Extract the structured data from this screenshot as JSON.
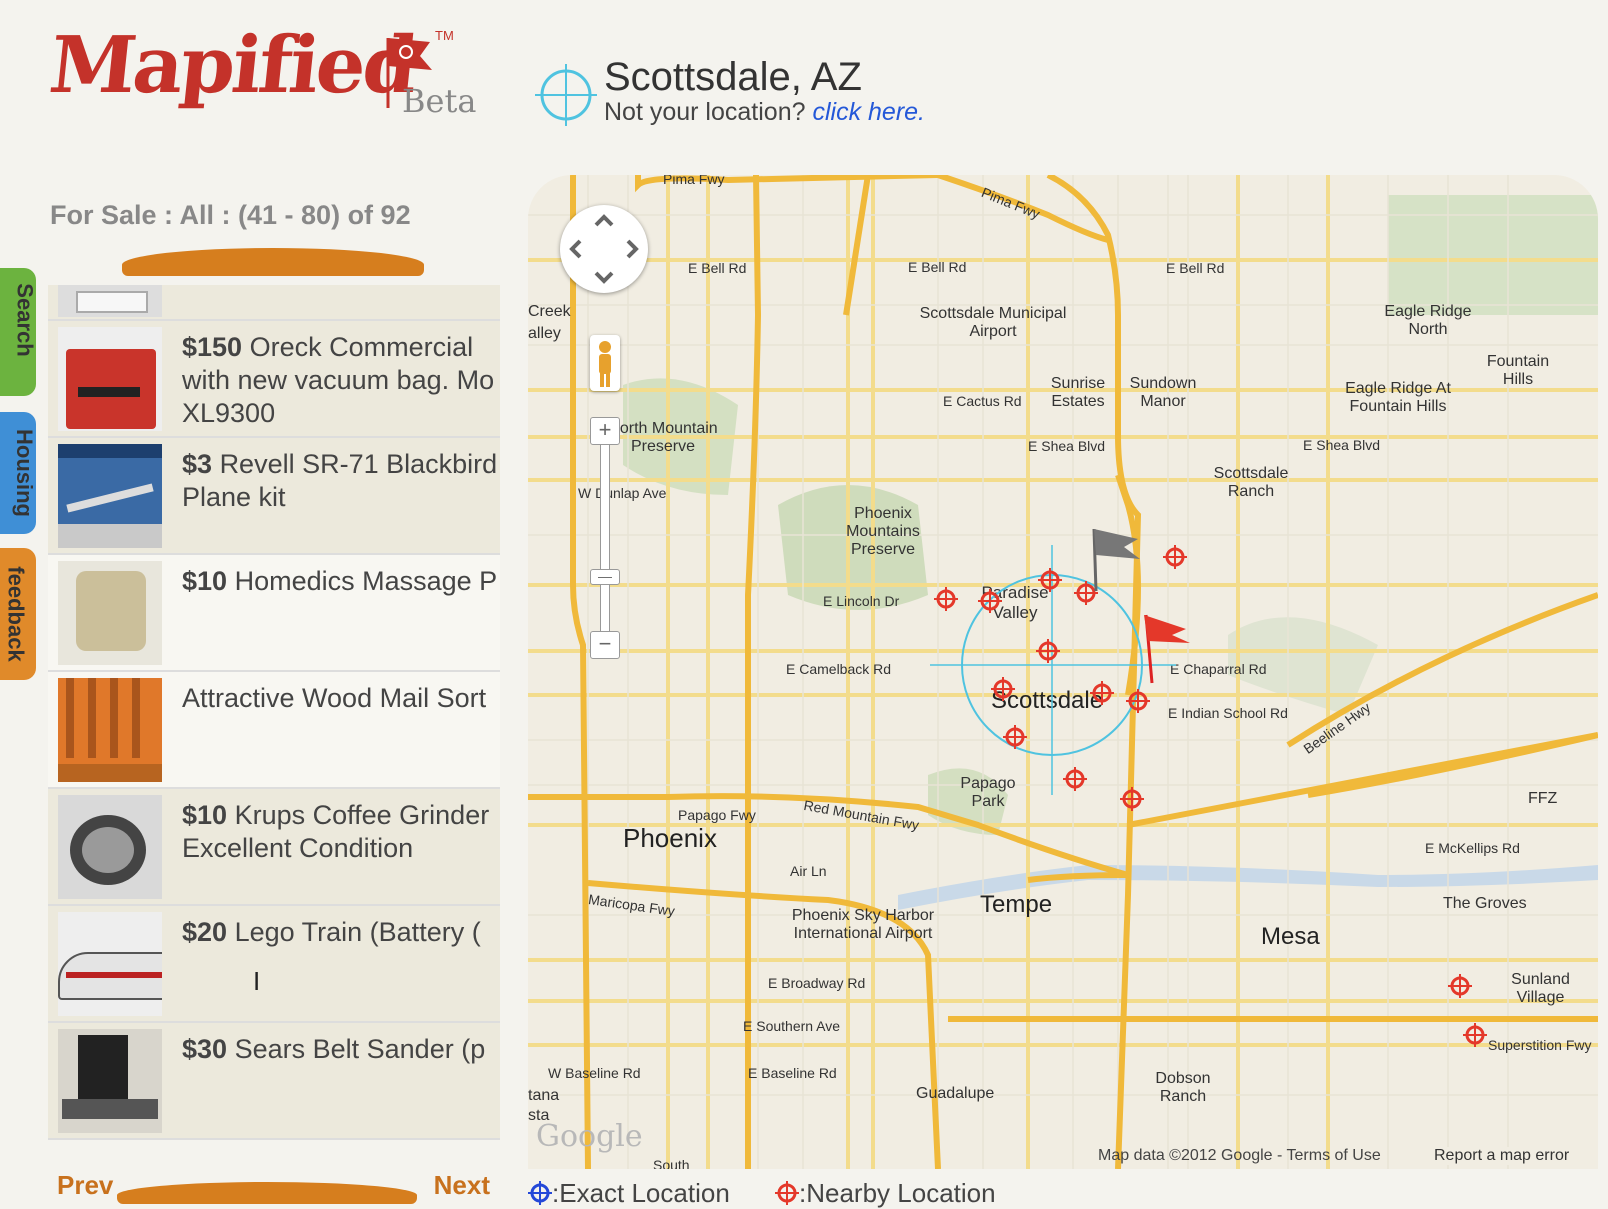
{
  "logo": {
    "name": "Mapified",
    "tm": "TM",
    "beta": "Beta"
  },
  "location": {
    "city": "Scottsdale, AZ",
    "prompt": "Not your location?",
    "link": "click here."
  },
  "side_tabs": [
    {
      "label": "Search",
      "color": "#6cb33f"
    },
    {
      "label": "Housing",
      "color": "#3f8fd6"
    },
    {
      "label": "feedback",
      "color": "#e08a2a"
    }
  ],
  "listing": {
    "header": "For Sale :  All :  (41 - 80) of 92",
    "items": [
      {
        "price": "$150",
        "title": "Oreck Commercial",
        "line2": "with new vacuum bag. Mo",
        "line3": "XL9300"
      },
      {
        "price": "$3",
        "title": "Revell SR-71 Blackbird",
        "line2": "Plane kit",
        "line3": ""
      },
      {
        "price": "$10",
        "title": "Homedics Massage P",
        "line2": "",
        "line3": ""
      },
      {
        "price": "",
        "title": "Attractive Wood Mail Sort",
        "line2": "",
        "line3": ""
      },
      {
        "price": "$10",
        "title": "Krups Coffee Grinder",
        "line2": "Excellent Condition",
        "line3": ""
      },
      {
        "price": "$20",
        "title": "Lego Train (Battery (",
        "line2": "",
        "line3": ""
      },
      {
        "price": "$30",
        "title": "Sears Belt Sander (p",
        "line2": "",
        "line3": ""
      }
    ],
    "prev": "Prev",
    "next": "Next"
  },
  "map": {
    "labels": {
      "phoenix": "Phoenix",
      "scottsdale": "Scottsdale",
      "tempe": "Tempe",
      "mesa": "Mesa",
      "paradise_valley": "Paradise Valley",
      "scottsdale_airport": "Scottsdale Municipal Airport",
      "sunrise": "Sunrise Estates",
      "sundown": "Sundown Manor",
      "eagle_ridge": "Eagle Ridge North",
      "fountain_hills": "Fountain Hills",
      "eagle_ridge_fh": "Eagle Ridge At Fountain Hills",
      "scottsdale_ranch": "Scottsdale Ranch",
      "phoenix_mountains": "Phoenix Mountains Preserve",
      "north_mountain": "North Mountain Preserve",
      "papago_park": "Papago Park",
      "sky_harbor": "Phoenix Sky Harbor International Airport",
      "the_groves": "The Groves",
      "sunland": "Sunland Village",
      "dobson": "Dobson Ranch",
      "guadalupe": "Guadalupe",
      "e_bell_rd": "E Bell Rd",
      "e_cactus_rd": "E Cactus Rd",
      "e_shea_blvd": "E Shea Blvd",
      "w_dunlap": "W Dunlap Ave",
      "e_lincoln": "E Lincoln Dr",
      "e_camelback": "E Camelback Rd",
      "e_chaparral": "E Chaparral Rd",
      "e_indian_school": "E Indian School Rd",
      "papago_fwy": "Papago Fwy",
      "red_mountain": "Red Mountain Fwy",
      "maricopa_fwy": "Maricopa Fwy",
      "air_ln": "Air Ln",
      "e_broadway": "E Broadway Rd",
      "e_southern": "E Southern Ave",
      "w_baseline": "W Baseline Rd",
      "e_baseline": "E Baseline Rd",
      "e_mckellips": "E McKellips Rd",
      "pima_fwy": "Pima Fwy",
      "beeline": "Beeline Hwy",
      "superstition": "Superstition Fwy",
      "ffz": "FFZ",
      "creek": "Creek",
      "alley": "alley",
      "tana": "tana",
      "sta": "sta",
      "south": "South"
    },
    "attribution": "Map data ©2012 Google - Terms of Use",
    "report": "Report a map error",
    "google": "Google"
  },
  "legend": {
    "exact": ":Exact Location",
    "nearby": ":Nearby Location"
  },
  "colors": {
    "brand": "#c4322a",
    "orange": "#d67e1e",
    "link": "#2458d8",
    "road": "#f5c045",
    "marker": "#e4382a"
  }
}
